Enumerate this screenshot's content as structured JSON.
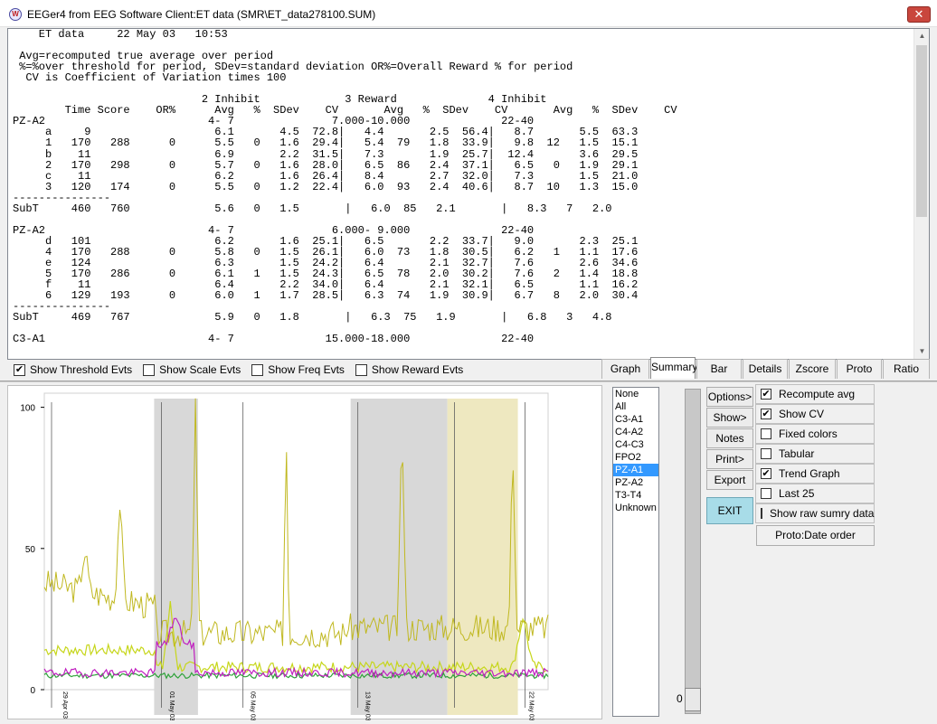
{
  "window": {
    "title": "EEGer4 from EEG Software  Client:ET data  (SMR\\ET_data278100.SUM)",
    "close_label": "✕"
  },
  "report_lines": [
    "    ET data     22 May 03   10:53",
    "",
    " Avg=recomputed true average over period",
    " %=%over threshold for period, SDev=standard deviation OR%=Overall Reward % for period",
    "  CV is Coefficient of Variation times 100",
    "",
    "                             2 Inhibit             3 Reward              4 Inhibit",
    "        Time Score    OR%      Avg   %  SDev    CV       Avg   %  SDev    CV       Avg   %  SDev    CV",
    "PZ-A2                         4- 7               7.000-10.000              22-40",
    "     a     9                   6.1       4.5  72.8|   4.4       2.5  56.4|   8.7       5.5  63.3",
    "     1   170   288      0      5.5   0   1.6  29.4|   5.4  79   1.8  33.9|   9.8  12   1.5  15.1",
    "     b    11                   6.9       2.2  31.5|   7.3       1.9  25.7|  12.4       3.6  29.5",
    "     2   170   298      0      5.7   0   1.6  28.0|   6.5  86   2.4  37.1|   6.5   0   1.9  29.1",
    "     c    11                   6.2       1.6  26.4|   8.4       2.7  32.0|   7.3       1.5  21.0",
    "     3   120   174      0      5.5   0   1.2  22.4|   6.0  93   2.4  40.6|   8.7  10   1.3  15.0",
    "---------------",
    "SubT     460   760             5.6   0   1.5       |   6.0  85   2.1       |   8.3   7   2.0",
    "",
    "PZ-A2                         4- 7               6.000- 9.000              22-40",
    "     d   101                   6.2       1.6  25.1|   6.5       2.2  33.7|   9.0       2.3  25.1",
    "     4   170   288      0      5.8   0   1.5  26.1|   6.0  73   1.8  30.5|   6.2   1   1.1  17.6",
    "     e   124                   6.3       1.5  24.2|   6.4       2.1  32.7|   7.6       2.6  34.6",
    "     5   170   286      0      6.1   1   1.5  24.3|   6.5  78   2.0  30.2|   7.6   2   1.4  18.8",
    "     f    11                   6.4       2.2  34.0|   6.4       2.1  32.1|   6.5       1.1  16.2",
    "     6   129   193      0      6.0   1   1.7  28.5|   6.3  74   1.9  30.9|   6.7   8   2.0  30.4",
    "---------------",
    "SubT     469   767             5.9   0   1.8       |   6.3  75   1.9       |   6.8   3   4.8",
    "",
    "C3-A1                         4- 7              15.000-18.000              22-40"
  ],
  "filters": [
    {
      "label": "Show Threshold Evts",
      "checked": true
    },
    {
      "label": "Show Scale Evts",
      "checked": false
    },
    {
      "label": "Show Freq Evts",
      "checked": false
    },
    {
      "label": "Show Reward Evts",
      "checked": false
    }
  ],
  "tabs": [
    {
      "label": "Graph",
      "active": false
    },
    {
      "label": "Summary",
      "active": true
    },
    {
      "label": "Bar",
      "active": false
    },
    {
      "label": "Details",
      "active": false
    },
    {
      "label": "Zscore",
      "active": false
    },
    {
      "label": "Proto",
      "active": false
    },
    {
      "label": "Ratio",
      "active": false
    }
  ],
  "channels": [
    "None",
    "All",
    "C3-A1",
    "C4-A2",
    "C4-C3",
    "FPO2",
    "PZ-A1",
    "PZ-A2",
    "T3-T4",
    "Unknown"
  ],
  "selected_channel": "PZ-A1",
  "buttons": [
    "Options>",
    "Show>",
    "Notes",
    "Print>",
    "Export"
  ],
  "exit_label": "EXIT",
  "options": [
    {
      "label": "Recompute avg",
      "checked": true
    },
    {
      "label": "Show CV",
      "checked": true
    },
    {
      "label": "Fixed colors",
      "checked": false
    },
    {
      "label": "Tabular",
      "checked": false
    },
    {
      "label": "Trend Graph",
      "checked": true
    },
    {
      "label": "Last 25",
      "checked": false
    },
    {
      "label": "Show raw sumry data",
      "checked": false
    }
  ],
  "proto_label": "Proto:Date order",
  "slider_value": "0",
  "chart_data": {
    "type": "line",
    "ylim": [
      0,
      105
    ],
    "yticks": [
      0,
      50,
      100
    ],
    "x_labels": [
      "29 Apr 03",
      "01 May 03",
      "05 May 03",
      "",
      "13 May 03",
      "",
      "22 May 03"
    ],
    "shaded_bands": [
      {
        "from": 0.218,
        "to": 0.305,
        "color": "#d8d8d8"
      },
      {
        "from": 0.608,
        "to": 0.8,
        "color": "#d8d8d8"
      },
      {
        "from": 0.8,
        "to": 0.94,
        "color": "#eee8c0"
      }
    ],
    "series_colors": [
      "#c6d61a",
      "#c0b820",
      "#2fa23a",
      "#c020c0"
    ]
  }
}
